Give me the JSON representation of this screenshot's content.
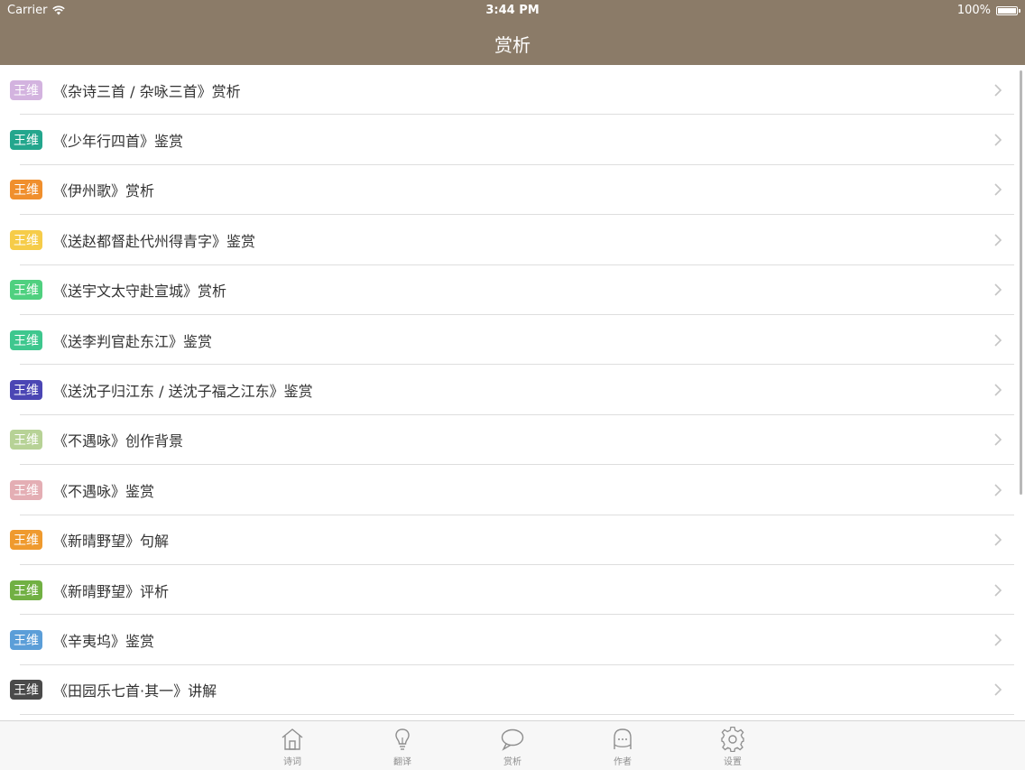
{
  "status_bar": {
    "carrier": "Carrier",
    "time": "3:44 PM",
    "battery": "100%"
  },
  "nav": {
    "title": "赏析"
  },
  "rows": [
    {
      "tag": "王维",
      "color": "#d3b3df",
      "title": "《杂诗三首 / 杂咏三首》赏析"
    },
    {
      "tag": "王维",
      "color": "#23a68d",
      "title": "《少年行四首》鉴赏"
    },
    {
      "tag": "王维",
      "color": "#f08f2d",
      "title": "《伊州歌》赏析"
    },
    {
      "tag": "王维",
      "color": "#f6cc49",
      "title": "《送赵都督赴代州得青字》鉴赏"
    },
    {
      "tag": "王维",
      "color": "#4fd07f",
      "title": "《送宇文太守赴宣城》赏析"
    },
    {
      "tag": "王维",
      "color": "#3ec78e",
      "title": "《送李判官赴东江》鉴赏"
    },
    {
      "tag": "王维",
      "color": "#4b46b4",
      "title": "《送沈子归江东 / 送沈子福之江东》鉴赏"
    },
    {
      "tag": "王维",
      "color": "#b7d296",
      "title": "《不遇咏》创作背景"
    },
    {
      "tag": "王维",
      "color": "#e4aeb4",
      "title": "《不遇咏》鉴赏"
    },
    {
      "tag": "王维",
      "color": "#ef9a2e",
      "title": "《新晴野望》句解"
    },
    {
      "tag": "王维",
      "color": "#71b043",
      "title": "《新晴野望》评析"
    },
    {
      "tag": "王维",
      "color": "#5b9ed8",
      "title": "《辛夷坞》鉴赏"
    },
    {
      "tag": "王维",
      "color": "#4a4a4a",
      "title": "《田园乐七首·其一》讲解"
    }
  ],
  "tabs": [
    {
      "label": "诗词",
      "icon": "house-icon"
    },
    {
      "label": "翻译",
      "icon": "lightbulb-icon"
    },
    {
      "label": "赏析",
      "icon": "speech-bubble-icon"
    },
    {
      "label": "作者",
      "icon": "person-face-icon"
    },
    {
      "label": "设置",
      "icon": "gear-icon"
    }
  ]
}
